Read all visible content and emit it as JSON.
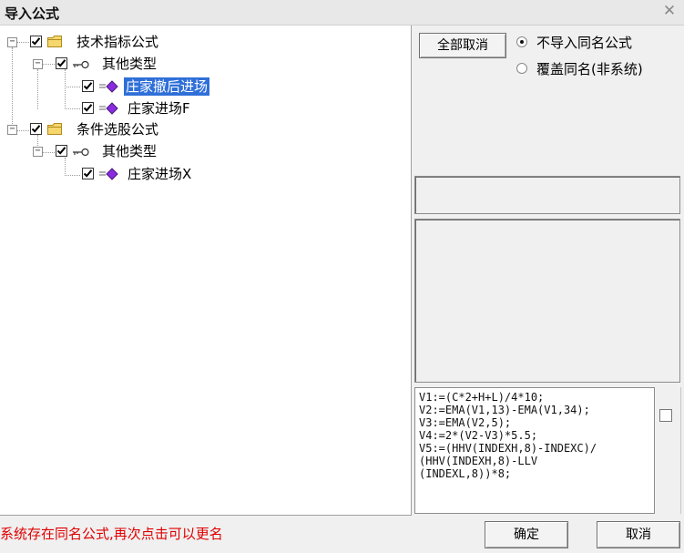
{
  "window": {
    "title": "导入公式",
    "close_glyph": "✕"
  },
  "tree": {
    "groups": [
      {
        "label": "技术指标公式",
        "icon": "folder-icon",
        "checked": true,
        "children": [
          {
            "label": "其他类型",
            "icon": "key-icon",
            "checked": true,
            "items": [
              {
                "label": "庄家撤后进场",
                "icon": "formula-icon",
                "checked": true,
                "selected": true
              },
              {
                "label": "庄家进场F",
                "icon": "formula-icon",
                "checked": true,
                "selected": false
              }
            ]
          }
        ]
      },
      {
        "label": "条件选股公式",
        "icon": "folder-icon",
        "checked": true,
        "children": [
          {
            "label": "其他类型",
            "icon": "key-icon",
            "checked": true,
            "items": [
              {
                "label": "庄家进场X",
                "icon": "formula-icon",
                "checked": true,
                "selected": false
              }
            ]
          }
        ]
      }
    ],
    "expander_minus": "−"
  },
  "options": {
    "cancel_all_label": "全部取消",
    "radio_no_import": "不导入同名公式",
    "radio_overwrite": "覆盖同名(非系统)",
    "selected_radio": "no_import"
  },
  "code": {
    "lines": [
      "V1:=(C*2+H+L)/4*10;",
      "V2:=EMA(V1,13)-EMA(V1,34);",
      "V3:=EMA(V2,5);",
      "V4:=2*(V2-V3)*5.5;",
      "V5:=(HHV(INDEXH,8)-INDEXC)/",
      "(HHV(INDEXH,8)-LLV",
      "(INDEXL,8))*8;"
    ]
  },
  "footer": {
    "status": "系统存在同名公式,再次点击可以更名",
    "ok_label": "确定",
    "cancel_label": "取消"
  },
  "colors": {
    "selection": "#2f6fd8",
    "status_text": "#e00000",
    "formula_icon": "#8a2be2",
    "folder": "#f5d76e"
  }
}
